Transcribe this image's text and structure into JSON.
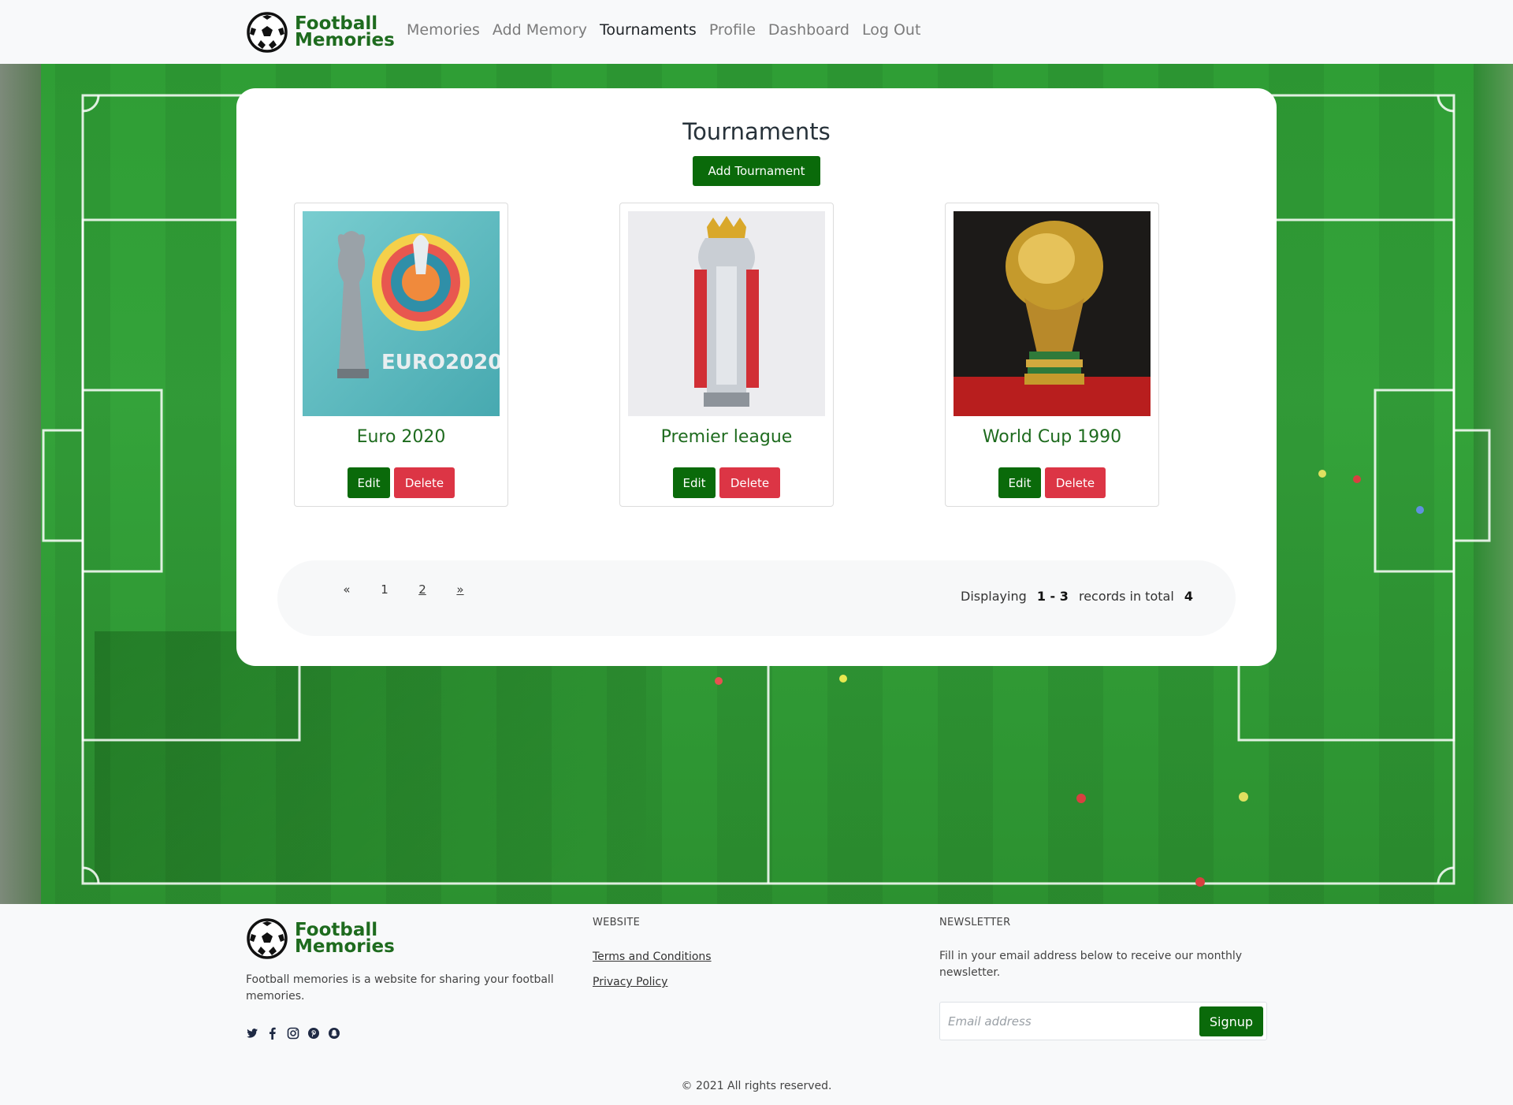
{
  "brand": {
    "line1": "Football",
    "line2": "Memories"
  },
  "nav": {
    "items": [
      {
        "label": "Memories"
      },
      {
        "label": "Add Memory"
      },
      {
        "label": "Tournaments",
        "active": true
      },
      {
        "label": "Profile"
      },
      {
        "label": "Dashboard"
      },
      {
        "label": "Log Out"
      }
    ]
  },
  "main": {
    "title": "Tournaments",
    "add_button": "Add Tournament",
    "cards": [
      {
        "title": "Euro 2020",
        "edit": "Edit",
        "delete": "Delete",
        "image": "euro-trophy"
      },
      {
        "title": "Premier league",
        "edit": "Edit",
        "delete": "Delete",
        "image": "premier-league-trophy"
      },
      {
        "title": "World Cup 1990",
        "edit": "Edit",
        "delete": "Delete",
        "image": "world-cup-trophy"
      }
    ],
    "pagination": {
      "prev": "«",
      "pages": [
        "1",
        "2"
      ],
      "next": "»"
    },
    "records": {
      "prefix": "Displaying",
      "range": "1 - 3",
      "middle": "records in total",
      "total": "4"
    }
  },
  "footer": {
    "description": "Football memories is a website for sharing your football memories.",
    "socials": [
      "twitter-icon",
      "facebook-icon",
      "instagram-icon",
      "pinterest-icon",
      "snapchat-icon"
    ],
    "website": {
      "heading": "WEBSITE",
      "links": [
        "Terms and Conditions",
        "Privacy Policy"
      ]
    },
    "newsletter": {
      "heading": "NEWSLETTER",
      "text": "Fill in your email address below to receive our monthly newsletter.",
      "placeholder": "Email address",
      "button": "Signup"
    },
    "copyright": "© 2021 All rights reserved."
  },
  "colors": {
    "brand_green": "#0a6a0a",
    "danger": "#dc3545",
    "title_green": "#1e6b1e"
  }
}
